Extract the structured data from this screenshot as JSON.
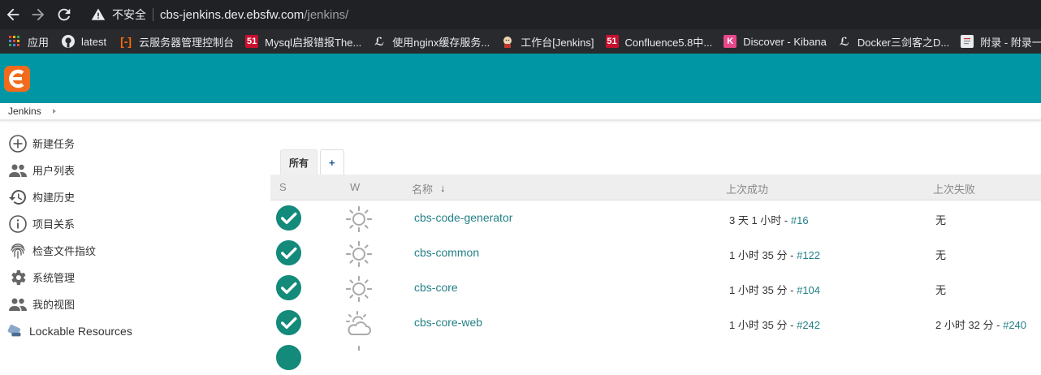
{
  "browser": {
    "insecure_label": "不安全",
    "url_host": "cbs-jenkins.dev.ebsfw.com",
    "url_path": "/jenkins/",
    "bookmarks": [
      {
        "label": "应用",
        "icon": "apps-grid-icon"
      },
      {
        "label": "latest",
        "icon": "github-icon"
      },
      {
        "label": "云服务器管理控制台",
        "icon": "aliyun-icon"
      },
      {
        "label": "Mysql启报错报The...",
        "icon": "51cto-icon"
      },
      {
        "label": "使用nginx缓存服务...",
        "icon": "feather-icon"
      },
      {
        "label": "工作台[Jenkins]",
        "icon": "jenkins-icon"
      },
      {
        "label": "Confluence5.8中...",
        "icon": "51cto-icon"
      },
      {
        "label": "Discover - Kibana",
        "icon": "kibana-icon"
      },
      {
        "label": "Docker三剑客之D...",
        "icon": "feather-icon"
      },
      {
        "label": "附录 - 附录一:",
        "icon": "document-icon"
      }
    ]
  },
  "breadcrumb": {
    "root": "Jenkins"
  },
  "sidebar": {
    "items": [
      {
        "label": "新建任务",
        "icon": "plus-circle-icon"
      },
      {
        "label": "用户列表",
        "icon": "people-icon"
      },
      {
        "label": "构建历史",
        "icon": "history-icon"
      },
      {
        "label": "项目关系",
        "icon": "info-icon"
      },
      {
        "label": "检查文件指纹",
        "icon": "fingerprint-icon"
      },
      {
        "label": "系统管理",
        "icon": "gear-icon"
      },
      {
        "label": "我的视图",
        "icon": "people-icon"
      },
      {
        "label": "Lockable Resources",
        "icon": "lockable-icon"
      }
    ]
  },
  "tabs": {
    "all": "所有",
    "add": "+"
  },
  "table": {
    "headers": {
      "s": "S",
      "w": "W",
      "name": "名称",
      "last_success": "上次成功",
      "last_failure": "上次失败"
    },
    "sort_arrow": "↓",
    "rows": [
      {
        "name": "cbs-code-generator",
        "weather": "sunny",
        "success_text": "3 天 1 小时 - ",
        "success_build": "#16",
        "failure_text": "无",
        "failure_build": ""
      },
      {
        "name": "cbs-common",
        "weather": "sunny",
        "success_text": "1 小时 35 分 - ",
        "success_build": "#122",
        "failure_text": "无",
        "failure_build": ""
      },
      {
        "name": "cbs-core",
        "weather": "sunny",
        "success_text": "1 小时 35 分 - ",
        "success_build": "#104",
        "failure_text": "无",
        "failure_build": ""
      },
      {
        "name": "cbs-core-web",
        "weather": "partly-cloudy",
        "success_text": "1 小时 35 分 - ",
        "success_build": "#242",
        "failure_text": "2 小时 32 分 - ",
        "failure_build": "#240"
      }
    ]
  },
  "colors": {
    "header": "#0096a4",
    "success": "#138a7a",
    "link": "#238086"
  }
}
